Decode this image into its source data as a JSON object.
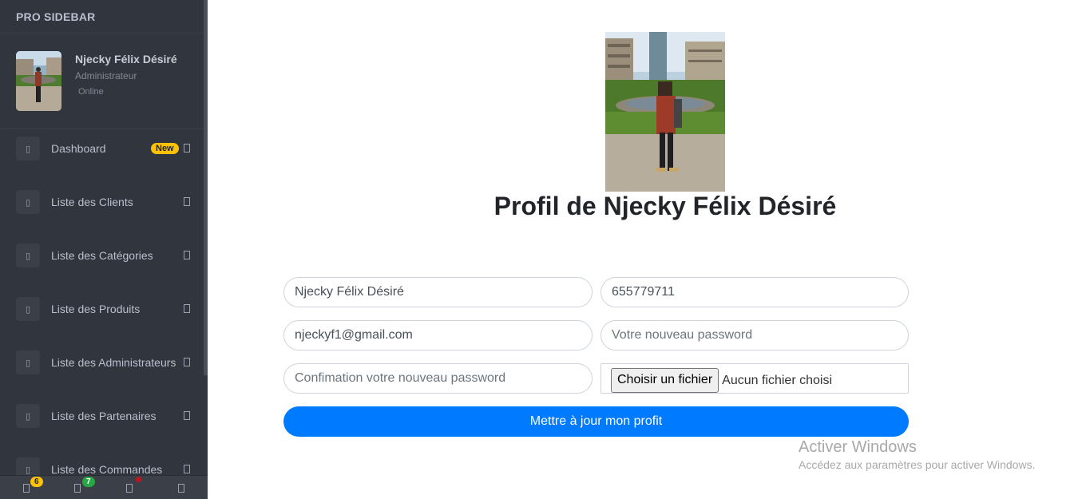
{
  "sidebar": {
    "brand": "PRO SIDEBAR",
    "user": {
      "name": "Njecky Félix Désiré",
      "role": "Administrateur",
      "status": "Online"
    },
    "items": [
      {
        "label": "Dashboard",
        "badge": "New",
        "icon": "dashboard-icon"
      },
      {
        "label": "Liste des Clients",
        "icon": "clients-icon"
      },
      {
        "label": "Liste des Catégories",
        "icon": "categories-icon"
      },
      {
        "label": "Liste des Produits",
        "icon": "products-icon"
      },
      {
        "label": "Liste des Administrateurs",
        "icon": "admins-icon"
      },
      {
        "label": "Liste des Partenaires",
        "icon": "partners-icon"
      },
      {
        "label": "Liste des Commandes",
        "icon": "orders-icon"
      }
    ],
    "footer": {
      "notifications_count": "6",
      "messages_count": "7",
      "notifications_color": "#ffc107",
      "messages_color": "#28a745",
      "alert_dot_color": "#c0161b"
    }
  },
  "profile": {
    "title_prefix": "Profil de",
    "title_name": "Njecky Félix Désiré",
    "form": {
      "name_value": "Njecky Félix Désiré",
      "phone_value": "655779711",
      "email_value": "njeckyf1@gmail.com",
      "password_placeholder": "Votre nouveau password",
      "confirm_placeholder": "Confimation votre nouveau password",
      "file_button": "Choisir un fichier",
      "file_status": "Aucun fichier choisi",
      "submit_label": "Mettre à jour mon profit"
    }
  },
  "watermark": {
    "title": "Activer Windows",
    "subtitle": "Accédez aux paramètres pour activer Windows."
  },
  "colors": {
    "sidebar_bg": "#31353d",
    "accent": "#007bff",
    "badge_new": "#ffc107"
  }
}
